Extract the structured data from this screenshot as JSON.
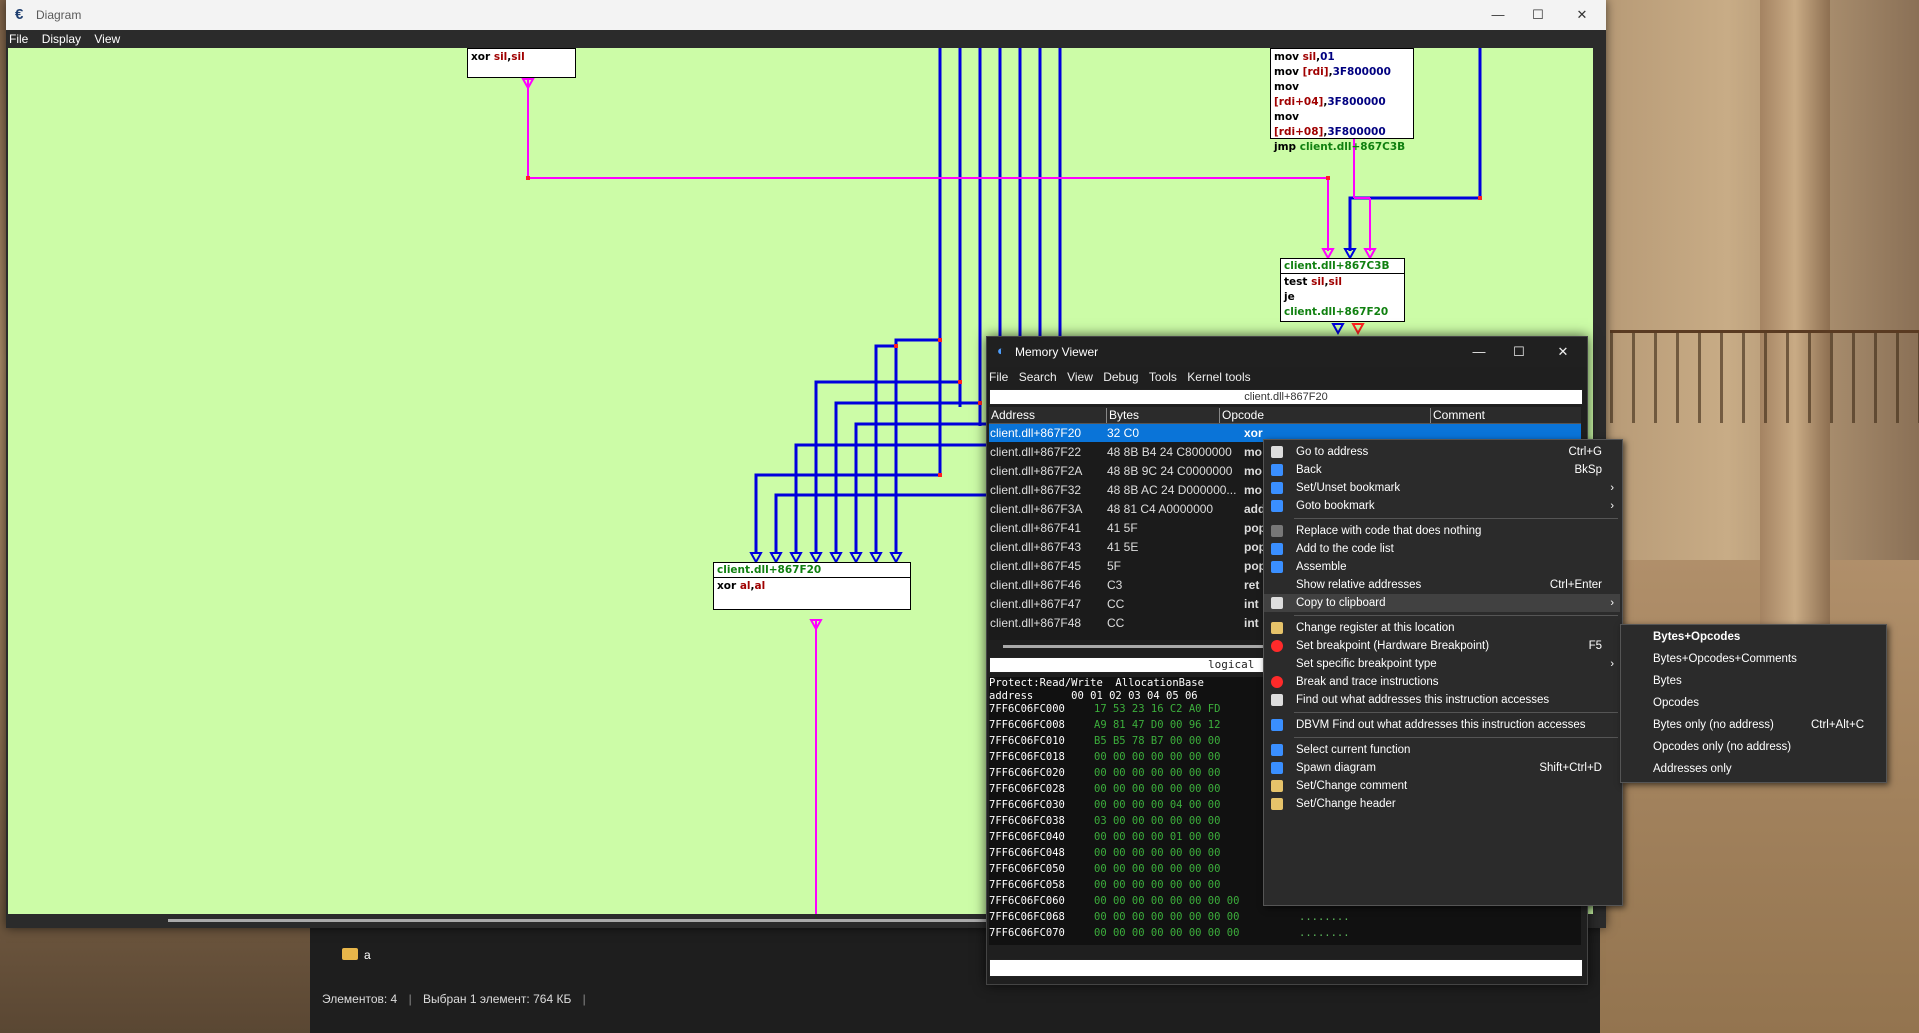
{
  "diagram_window": {
    "title": "Diagram",
    "menu": [
      "File",
      "Display",
      "View"
    ],
    "nodes": {
      "top_left": {
        "line": [
          "xor",
          " ",
          "sil",
          ",",
          "sil"
        ]
      },
      "top_right": {
        "lines": [
          [
            "mov",
            " ",
            "sil",
            ",",
            "01"
          ],
          [
            "mov",
            " ",
            "[rdi]",
            ",",
            "3F800000"
          ],
          [
            "mov",
            " ",
            "[rdi+04]",
            ",",
            "3F800000"
          ],
          [
            "mov",
            " ",
            "[rdi+08]",
            ",",
            "3F800000"
          ],
          [
            "jmp",
            " ",
            "client.dll+867C3B",
            "",
            ""
          ]
        ]
      },
      "mid_right": {
        "header": "client.dll+867C3B",
        "lines": [
          [
            "test",
            " ",
            "sil",
            ",",
            "sil"
          ],
          [
            "je",
            " ",
            "client.dll+867F20",
            "",
            ""
          ]
        ]
      },
      "center": {
        "header": "client.dll+867F20",
        "line": [
          "xor",
          " ",
          "al",
          ",",
          "al"
        ]
      }
    },
    "colors": {
      "canvas": "#ccfca7",
      "magenta": "#ff00ff",
      "blue": "#0000dd",
      "red": "#ff2020"
    }
  },
  "explorer": {
    "folder_name": "a",
    "status_count": "Элементов: 4",
    "status_selected": "Выбран 1 элемент: 764 КБ"
  },
  "memory_viewer": {
    "title": "Memory Viewer",
    "menu": [
      "File",
      "Search",
      "View",
      "Debug",
      "Tools",
      "Kernel tools"
    ],
    "address_bar": "client.dll+867F20",
    "columns": [
      "Address",
      "Bytes",
      "Opcode",
      "Comment"
    ],
    "rows": [
      {
        "address": "client.dll+867F20",
        "bytes": "32 C0",
        "opcode": "xor"
      },
      {
        "address": "client.dll+867F22",
        "bytes": "48 8B B4 24 C8000000",
        "opcode": "mo"
      },
      {
        "address": "client.dll+867F2A",
        "bytes": "48 8B 9C 24 C0000000",
        "opcode": "mo"
      },
      {
        "address": "client.dll+867F32",
        "bytes": "48 8B AC 24 D000000...",
        "opcode": "mo"
      },
      {
        "address": "client.dll+867F3A",
        "bytes": "48 81 C4 A0000000",
        "opcode": "add"
      },
      {
        "address": "client.dll+867F41",
        "bytes": "41 5F",
        "opcode": "pop"
      },
      {
        "address": "client.dll+867F43",
        "bytes": "41 5E",
        "opcode": "pop"
      },
      {
        "address": "client.dll+867F45",
        "bytes": "5F",
        "opcode": "pop"
      },
      {
        "address": "client.dll+867F46",
        "bytes": "C3",
        "opcode": "ret"
      },
      {
        "address": "client.dll+867F47",
        "bytes": "CC",
        "opcode": "int"
      },
      {
        "address": "client.dll+867F48",
        "bytes": "CC",
        "opcode": "int"
      }
    ],
    "log_bar": "logical",
    "hex_header1": "Protect:Read/Write  AllocationBase",
    "hex_header2": "address      00 01 02 03 04 05 06",
    "hex_rows": [
      {
        "addr": "7FF6C06FC000",
        "bytes": "17 53 23 16 C2 A0 FD",
        "ascii": ""
      },
      {
        "addr": "7FF6C06FC008",
        "bytes": "A9 81 47 D0 00 96 12",
        "ascii": ""
      },
      {
        "addr": "7FF6C06FC010",
        "bytes": "B5 B5 78 B7 00 00 00",
        "ascii": ""
      },
      {
        "addr": "7FF6C06FC018",
        "bytes": "00 00 00 00 00 00 00",
        "ascii": ""
      },
      {
        "addr": "7FF6C06FC020",
        "bytes": "00 00 00 00 00 00 00",
        "ascii": ""
      },
      {
        "addr": "7FF6C06FC028",
        "bytes": "00 00 00 00 00 00 00",
        "ascii": ""
      },
      {
        "addr": "7FF6C06FC030",
        "bytes": "00 00 00 00 04 00 00",
        "ascii": ""
      },
      {
        "addr": "7FF6C06FC038",
        "bytes": "03 00 00 00 00 00 00",
        "ascii": ""
      },
      {
        "addr": "7FF6C06FC040",
        "bytes": "00 00 00 00 01 00 00",
        "ascii": ""
      },
      {
        "addr": "7FF6C06FC048",
        "bytes": "00 00 00 00 00 00 00",
        "ascii": ""
      },
      {
        "addr": "7FF6C06FC050",
        "bytes": "00 00 00 00 00 00 00",
        "ascii": ""
      },
      {
        "addr": "7FF6C06FC058",
        "bytes": "00 00 00 00 00 00 00",
        "ascii": ""
      },
      {
        "addr": "7FF6C06FC060",
        "bytes": "00 00 00 00 00 00 00 00",
        "ascii": "........"
      },
      {
        "addr": "7FF6C06FC068",
        "bytes": "00 00 00 00 00 00 00 00",
        "ascii": "........"
      },
      {
        "addr": "7FF6C06FC070",
        "bytes": "00 00 00 00 00 00 00 00",
        "ascii": "........"
      }
    ]
  },
  "context_menu": {
    "items": [
      {
        "label": "Go to address",
        "shortcut": "Ctrl+G",
        "icon": "page-icon",
        "submenu": false
      },
      {
        "label": "Back",
        "shortcut": "BkSp",
        "icon": "back-arrow-icon",
        "submenu": false
      },
      {
        "label": "Set/Unset bookmark",
        "shortcut": "",
        "icon": "bookmark-icon",
        "submenu": true
      },
      {
        "label": "Goto bookmark",
        "shortcut": "",
        "icon": "bookmark-goto-icon",
        "submenu": true
      },
      {
        "sep": true
      },
      {
        "label": "Replace with code that does nothing",
        "shortcut": "",
        "icon": "nop-icon",
        "submenu": false
      },
      {
        "label": "Add to the code list",
        "shortcut": "",
        "icon": "plus-icon",
        "submenu": false
      },
      {
        "label": "Assemble",
        "shortcut": "",
        "icon": "assemble-icon",
        "submenu": false
      },
      {
        "label": "Show relative addresses",
        "shortcut": "Ctrl+Enter",
        "icon": "",
        "submenu": false
      },
      {
        "label": "Copy to clipboard",
        "shortcut": "",
        "icon": "copy-icon",
        "submenu": true,
        "highlight": true
      },
      {
        "sep": true
      },
      {
        "label": "Change register at this location",
        "shortcut": "",
        "icon": "register-icon",
        "submenu": false
      },
      {
        "label": "Set breakpoint (Hardware Breakpoint)",
        "shortcut": "F5",
        "icon": "breakpoint-icon",
        "submenu": false
      },
      {
        "label": "Set specific breakpoint type",
        "shortcut": "",
        "icon": "",
        "submenu": true
      },
      {
        "label": "Break and trace instructions",
        "shortcut": "",
        "icon": "trace-icon",
        "submenu": false
      },
      {
        "label": "Find out what addresses this instruction accesses",
        "shortcut": "",
        "icon": "magnifier-icon",
        "submenu": false
      },
      {
        "sep": true
      },
      {
        "label": "DBVM Find out what addresses this instruction accesses",
        "shortcut": "",
        "icon": "dbvm-icon",
        "submenu": false
      },
      {
        "sep": true
      },
      {
        "label": "Select current function",
        "shortcut": "",
        "icon": "function-icon",
        "submenu": false
      },
      {
        "label": "Spawn diagram",
        "shortcut": "Shift+Ctrl+D",
        "icon": "diagram-icon",
        "submenu": false
      },
      {
        "label": "Set/Change comment",
        "shortcut": "",
        "icon": "comment-icon",
        "submenu": false
      },
      {
        "label": "Set/Change header",
        "shortcut": "",
        "icon": "header-icon",
        "submenu": false
      }
    ]
  },
  "submenu": {
    "items": [
      {
        "label": "Bytes+Opcodes",
        "shortcut": "",
        "bold": true
      },
      {
        "label": "Bytes+Opcodes+Comments",
        "shortcut": ""
      },
      {
        "label": "Bytes",
        "shortcut": ""
      },
      {
        "label": "Opcodes",
        "shortcut": ""
      },
      {
        "label": "Bytes only (no address)",
        "shortcut": "Ctrl+Alt+C"
      },
      {
        "label": "Opcodes only (no address)",
        "shortcut": ""
      },
      {
        "label": "Addresses only",
        "shortcut": ""
      }
    ]
  }
}
